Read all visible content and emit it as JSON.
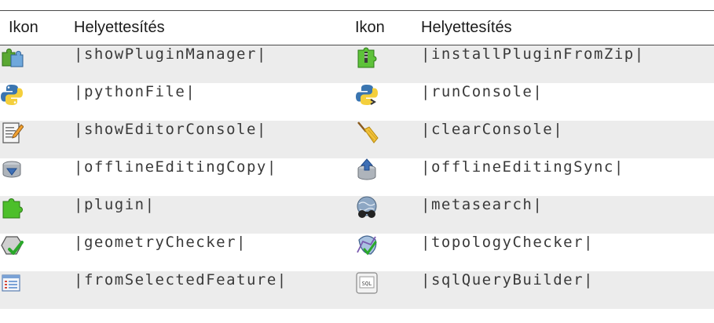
{
  "header": {
    "col1": "Ikon",
    "col2": "Helyettesítés",
    "col3": "Ikon",
    "col4": "Helyettesítés"
  },
  "rows": [
    {
      "left": {
        "icon": "plugin-manager-icon",
        "name": "|showPluginManager|"
      },
      "right": {
        "icon": "install-plugin-zip-icon",
        "name": "|installPluginFromZip|"
      }
    },
    {
      "left": {
        "icon": "python-file-icon",
        "name": "|pythonFile|"
      },
      "right": {
        "icon": "run-console-icon",
        "name": "|runConsole|"
      }
    },
    {
      "left": {
        "icon": "editor-console-icon",
        "name": "|showEditorConsole|"
      },
      "right": {
        "icon": "clear-console-broom-icon",
        "name": "|clearConsole|"
      }
    },
    {
      "left": {
        "icon": "offline-editing-copy-icon",
        "name": "|offlineEditingCopy|"
      },
      "right": {
        "icon": "offline-editing-sync-icon",
        "name": "|offlineEditingSync|"
      }
    },
    {
      "left": {
        "icon": "plugin-icon",
        "name": "|plugin|"
      },
      "right": {
        "icon": "metasearch-icon",
        "name": "|metasearch|"
      }
    },
    {
      "left": {
        "icon": "geometry-checker-icon",
        "name": "|geometryChecker|"
      },
      "right": {
        "icon": "topology-checker-icon",
        "name": "|topologyChecker|"
      }
    },
    {
      "left": {
        "icon": "from-selected-feature-icon",
        "name": "|fromSelectedFeature|"
      },
      "right": {
        "icon": "sql-query-builder-icon",
        "name": "|sqlQueryBuilder|"
      }
    }
  ],
  "colors": {
    "row_alt": "#ececec",
    "rule": "#4a4a4a",
    "text": "#3a3a3a"
  }
}
